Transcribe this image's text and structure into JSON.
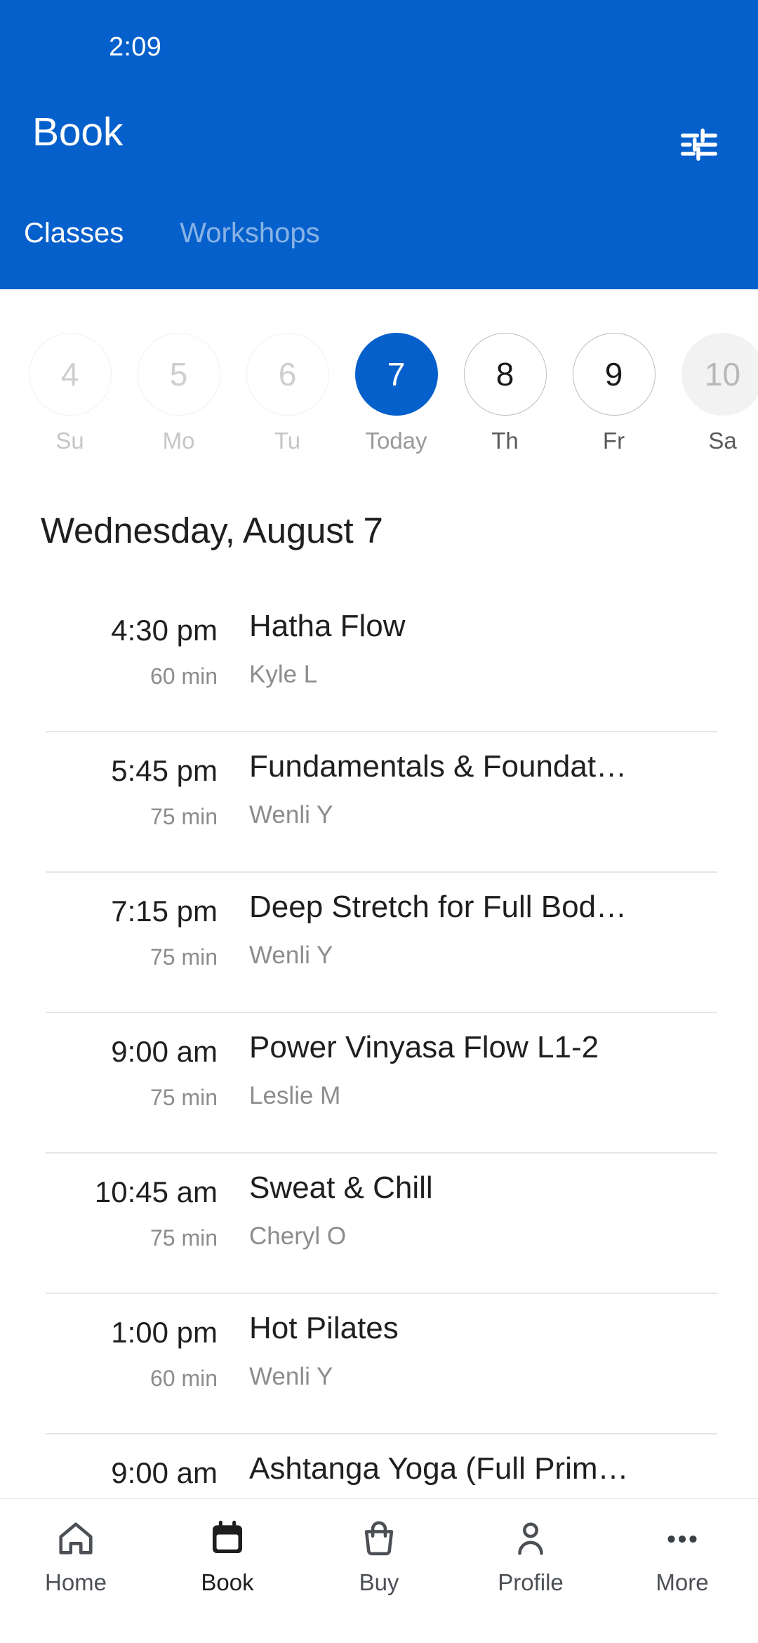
{
  "status_bar": {
    "time": "2:09"
  },
  "app_bar": {
    "title": "Book",
    "filter_icon": "tune-icon",
    "accent_color": "#0660cb"
  },
  "tabs": [
    {
      "label": "Classes",
      "active": true
    },
    {
      "label": "Workshops",
      "active": false
    }
  ],
  "date_strip": {
    "days": [
      {
        "number": "4",
        "label": "Su",
        "state": "disabled"
      },
      {
        "number": "5",
        "label": "Mo",
        "state": "disabled"
      },
      {
        "number": "6",
        "label": "Tu",
        "state": "disabled"
      },
      {
        "number": "7",
        "label": "Today",
        "state": "selected"
      },
      {
        "number": "8",
        "label": "Th",
        "state": "normal"
      },
      {
        "number": "9",
        "label": "Fr",
        "state": "normal"
      },
      {
        "number": "10",
        "label": "Sa",
        "state": "shaded"
      }
    ]
  },
  "schedule": {
    "heading": "Wednesday, August 7",
    "classes": [
      {
        "time": "4:30 pm",
        "duration": "60 min",
        "name": "Hatha Flow",
        "teacher": "Kyle L"
      },
      {
        "time": "5:45 pm",
        "duration": "75 min",
        "name": "Fundamentals & Foundat…",
        "teacher": "Wenli Y"
      },
      {
        "time": "7:15 pm",
        "duration": "75 min",
        "name": "Deep Stretch for Full Bod…",
        "teacher": "Wenli Y"
      },
      {
        "time": "9:00 am",
        "duration": "75 min",
        "name": "Power Vinyasa Flow L1-2",
        "teacher": "Leslie M"
      },
      {
        "time": "10:45 am",
        "duration": "75 min",
        "name": "Sweat & Chill",
        "teacher": "Cheryl O"
      },
      {
        "time": "1:00 pm",
        "duration": "60 min",
        "name": "Hot Pilates",
        "teacher": "Wenli Y"
      },
      {
        "time": "9:00 am",
        "duration": "",
        "name": "Ashtanga Yoga (Full Prim…",
        "teacher": ""
      }
    ]
  },
  "bottom_nav": {
    "items": [
      {
        "label": "Home",
        "icon": "home-icon",
        "active": false
      },
      {
        "label": "Book",
        "icon": "calendar-icon",
        "active": true
      },
      {
        "label": "Buy",
        "icon": "bag-icon",
        "active": false
      },
      {
        "label": "Profile",
        "icon": "person-icon",
        "active": false
      },
      {
        "label": "More",
        "icon": "dots-icon",
        "active": false
      }
    ]
  }
}
